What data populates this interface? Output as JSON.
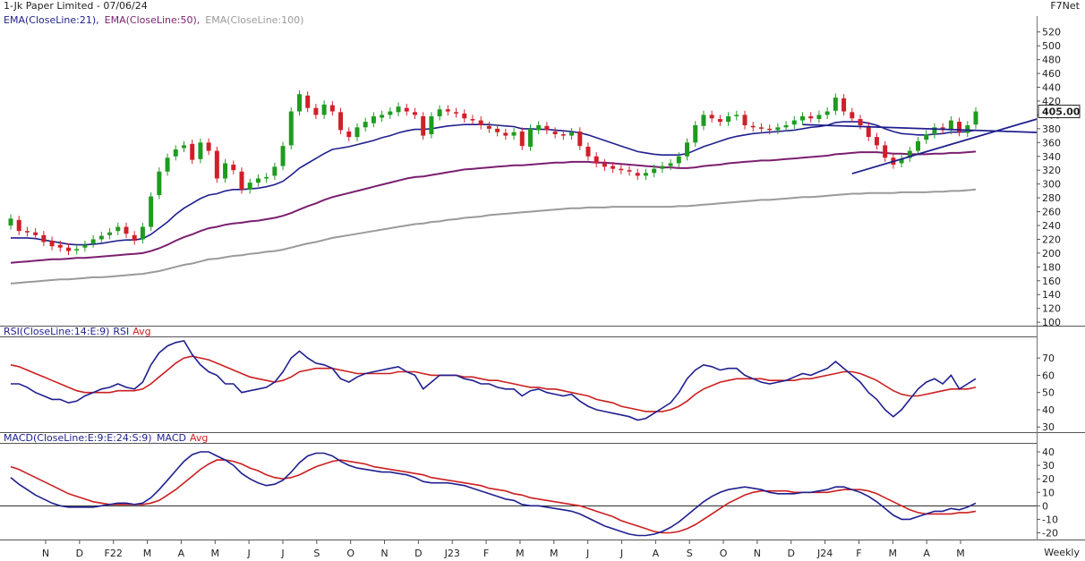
{
  "header": {
    "title": "1-Jk Paper Limited - 07/06/24",
    "source": "F7Net",
    "timeframe": "Weekly",
    "ema_legend": [
      {
        "label": "EMA(CloseLine:21),",
        "color": "#1f1f8f"
      },
      {
        "label": "EMA(CloseLine:50),",
        "color": "#7b1f6f"
      },
      {
        "label": "EMA(CloseLine:100)",
        "color": "#9a9a9a"
      }
    ],
    "rsi_legend": [
      {
        "label": "RSI(CloseLine:14:E:9)",
        "color": "#1f1f8f"
      },
      {
        "label": "RSI",
        "color": "#1f1f8f"
      },
      {
        "label": "Avg",
        "color": "#cc1f1f"
      }
    ],
    "macd_legend": [
      {
        "label": "MACD(CloseLine:E:9:E:24:S:9)_MACD",
        "color": "#1f1f8f"
      },
      {
        "label": "Avg",
        "color": "#cc1f1f"
      }
    ]
  },
  "chart_data": [
    {
      "type": "candlestick",
      "panel": "price",
      "yticks": [
        100,
        120,
        140,
        160,
        180,
        200,
        220,
        240,
        260,
        280,
        300,
        320,
        340,
        360,
        380,
        400,
        420,
        440,
        460,
        480,
        500,
        520
      ],
      "ylim": [
        95,
        530
      ],
      "last_price_label": "405.00",
      "x_labels": [
        "N",
        "D",
        "F22",
        "M",
        "A",
        "M",
        "J",
        "J",
        "S",
        "O",
        "N",
        "D",
        "J23",
        "F",
        "M",
        "M",
        "J",
        "J",
        "A",
        "S",
        "O",
        "N",
        "D",
        "J24",
        "F",
        "M",
        "A",
        "M"
      ],
      "close": [
        250,
        232,
        230,
        226,
        216,
        210,
        208,
        203,
        206,
        212,
        220,
        225,
        230,
        238,
        228,
        218,
        238,
        282,
        318,
        338,
        350,
        356,
        335,
        360,
        348,
        308,
        330,
        320,
        292,
        302,
        308,
        310,
        325,
        355,
        405,
        430,
        410,
        400,
        415,
        405,
        378,
        368,
        382,
        390,
        398,
        400,
        405,
        412,
        405,
        400,
        370,
        398,
        408,
        405,
        402,
        395,
        392,
        385,
        380,
        375,
        370,
        375,
        355,
        380,
        385,
        378,
        372,
        370,
        375,
        355,
        340,
        330,
        325,
        322,
        320,
        318,
        312,
        316,
        322,
        326,
        330,
        340,
        360,
        385,
        400,
        395,
        390,
        398,
        400,
        385,
        382,
        380,
        378,
        382,
        385,
        392,
        398,
        395,
        400,
        405,
        425,
        405,
        395,
        385,
        368,
        356,
        338,
        328,
        336,
        348,
        362,
        372,
        382,
        378,
        392,
        375,
        385,
        405
      ],
      "open": [
        240,
        248,
        232,
        230,
        226,
        218,
        212,
        208,
        204,
        208,
        214,
        220,
        226,
        232,
        238,
        226,
        220,
        238,
        284,
        318,
        340,
        352,
        358,
        336,
        360,
        348,
        308,
        328,
        318,
        292,
        302,
        308,
        312,
        326,
        356,
        405,
        428,
        410,
        400,
        414,
        404,
        376,
        368,
        382,
        388,
        396,
        400,
        404,
        410,
        404,
        398,
        372,
        398,
        408,
        404,
        402,
        394,
        392,
        384,
        380,
        374,
        370,
        376,
        354,
        378,
        384,
        376,
        372,
        370,
        376,
        354,
        340,
        330,
        326,
        322,
        320,
        316,
        312,
        316,
        322,
        326,
        330,
        340,
        360,
        384,
        400,
        394,
        390,
        398,
        400,
        384,
        382,
        380,
        378,
        382,
        386,
        392,
        398,
        394,
        400,
        406,
        424,
        404,
        394,
        384,
        368,
        356,
        338,
        330,
        338,
        348,
        364,
        372,
        382,
        378,
        390,
        374,
        386
      ],
      "ema21": [
        222,
        222,
        222,
        221,
        219,
        217,
        215,
        213,
        212,
        212,
        213,
        214,
        216,
        218,
        219,
        219,
        221,
        227,
        236,
        245,
        256,
        265,
        272,
        279,
        284,
        286,
        290,
        292,
        292,
        293,
        294,
        296,
        299,
        304,
        313,
        323,
        330,
        337,
        344,
        350,
        352,
        354,
        357,
        360,
        363,
        367,
        370,
        374,
        377,
        379,
        379,
        380,
        382,
        384,
        385,
        386,
        386,
        386,
        386,
        385,
        384,
        383,
        380,
        380,
        379,
        379,
        378,
        377,
        376,
        374,
        371,
        367,
        363,
        359,
        355,
        351,
        347,
        345,
        343,
        342,
        342,
        342,
        344,
        349,
        354,
        358,
        362,
        366,
        369,
        371,
        373,
        374,
        375,
        376,
        377,
        378,
        380,
        382,
        383,
        385,
        389,
        390,
        390,
        390,
        388,
        385,
        380,
        376,
        373,
        372,
        371,
        371,
        372,
        373,
        375,
        375,
        376,
        378
      ],
      "ema50": [
        186,
        187,
        188,
        189,
        190,
        191,
        191,
        192,
        193,
        193,
        194,
        195,
        196,
        197,
        198,
        199,
        200,
        203,
        207,
        212,
        218,
        223,
        227,
        232,
        236,
        238,
        241,
        243,
        244,
        246,
        247,
        249,
        251,
        254,
        258,
        263,
        268,
        272,
        277,
        281,
        284,
        287,
        290,
        293,
        296,
        299,
        302,
        305,
        308,
        310,
        311,
        313,
        315,
        317,
        319,
        321,
        322,
        323,
        324,
        325,
        326,
        327,
        327,
        328,
        329,
        330,
        331,
        331,
        332,
        332,
        332,
        331,
        331,
        330,
        329,
        328,
        327,
        326,
        325,
        324,
        324,
        323,
        323,
        324,
        326,
        327,
        328,
        330,
        331,
        332,
        333,
        334,
        334,
        335,
        336,
        337,
        338,
        339,
        340,
        341,
        343,
        344,
        345,
        346,
        346,
        346,
        345,
        344,
        344,
        343,
        343,
        343,
        344,
        344,
        345,
        345,
        346,
        347
      ],
      "ema100": [
        156,
        157,
        158,
        159,
        160,
        161,
        162,
        162,
        163,
        164,
        165,
        165,
        166,
        167,
        168,
        169,
        170,
        172,
        174,
        177,
        180,
        183,
        185,
        188,
        191,
        192,
        194,
        196,
        197,
        199,
        200,
        202,
        203,
        205,
        208,
        211,
        214,
        216,
        219,
        222,
        224,
        226,
        228,
        230,
        232,
        234,
        236,
        238,
        240,
        242,
        243,
        245,
        246,
        248,
        249,
        251,
        252,
        253,
        255,
        256,
        257,
        258,
        259,
        260,
        261,
        262,
        263,
        264,
        265,
        265,
        266,
        266,
        266,
        267,
        267,
        267,
        267,
        267,
        267,
        267,
        267,
        268,
        268,
        269,
        270,
        271,
        272,
        273,
        274,
        275,
        276,
        277,
        277,
        278,
        279,
        280,
        281,
        281,
        282,
        283,
        284,
        285,
        286,
        286,
        287,
        287,
        287,
        287,
        288,
        288,
        288,
        288,
        289,
        289,
        290,
        290,
        291,
        292
      ],
      "trendline_upper": [
        {
          "week": 96,
          "price": 386
        },
        {
          "week": 121,
          "price": 376
        }
      ],
      "trendline_lower": [
        {
          "week": 102,
          "price": 315
        },
        {
          "week": 121,
          "price": 382
        }
      ]
    },
    {
      "type": "line",
      "panel": "rsi",
      "yticks": [
        30,
        40,
        50,
        60,
        70
      ],
      "ylim": [
        27,
        82
      ],
      "series": [
        {
          "name": "RSI",
          "color": "#1f1f8f",
          "values": [
            55,
            55,
            53,
            50,
            48,
            46,
            46,
            44,
            45,
            48,
            50,
            52,
            53,
            55,
            53,
            52,
            56,
            66,
            73,
            77,
            79,
            80,
            72,
            66,
            62,
            60,
            55,
            55,
            50,
            51,
            52,
            53,
            56,
            62,
            70,
            74,
            70,
            67,
            66,
            64,
            58,
            56,
            59,
            61,
            62,
            63,
            64,
            65,
            62,
            60,
            52,
            56,
            60,
            60,
            60,
            58,
            57,
            55,
            55,
            53,
            52,
            52,
            48,
            51,
            52,
            50,
            49,
            48,
            49,
            45,
            42,
            40,
            39,
            38,
            37,
            36,
            34,
            35,
            38,
            41,
            44,
            50,
            58,
            63,
            66,
            65,
            63,
            64,
            64,
            60,
            58,
            56,
            55,
            56,
            57,
            59,
            61,
            60,
            62,
            64,
            68,
            64,
            60,
            56,
            50,
            46,
            40,
            36,
            40,
            46,
            52,
            56,
            58,
            55,
            60,
            52,
            55,
            58
          ]
        },
        {
          "name": "Avg",
          "color": "#cc1f1f",
          "values": [
            66,
            65,
            63,
            61,
            59,
            57,
            55,
            53,
            51,
            50,
            50,
            50,
            50,
            51,
            51,
            51,
            52,
            55,
            59,
            63,
            67,
            70,
            71,
            70,
            69,
            67,
            65,
            63,
            61,
            59,
            58,
            57,
            56,
            57,
            59,
            62,
            63,
            64,
            64,
            64,
            63,
            62,
            61,
            61,
            61,
            61,
            61,
            62,
            62,
            62,
            61,
            60,
            60,
            60,
            60,
            59,
            59,
            58,
            57,
            57,
            56,
            55,
            54,
            53,
            53,
            52,
            52,
            51,
            50,
            49,
            48,
            46,
            45,
            44,
            42,
            41,
            40,
            39,
            39,
            39,
            40,
            42,
            45,
            49,
            52,
            54,
            56,
            57,
            58,
            58,
            58,
            58,
            57,
            57,
            57,
            57,
            58,
            58,
            59,
            60,
            61,
            62,
            62,
            61,
            59,
            57,
            54,
            51,
            49,
            48,
            48,
            49,
            50,
            51,
            52,
            52,
            52,
            53
          ]
        }
      ]
    },
    {
      "type": "line",
      "panel": "macd",
      "yticks": [
        -20,
        -10,
        0,
        10,
        20,
        30,
        40
      ],
      "ylim": [
        -25,
        46
      ],
      "series": [
        {
          "name": "MACD",
          "color": "#1f1f8f",
          "values": [
            21,
            16,
            12,
            8,
            5,
            2,
            0,
            -1,
            -1,
            -1,
            -1,
            0,
            1,
            2,
            2,
            1,
            2,
            6,
            12,
            19,
            26,
            33,
            38,
            40,
            40,
            37,
            34,
            30,
            24,
            20,
            17,
            15,
            16,
            19,
            25,
            32,
            37,
            39,
            39,
            37,
            33,
            30,
            28,
            27,
            26,
            25,
            25,
            24,
            23,
            21,
            18,
            17,
            17,
            17,
            16,
            15,
            13,
            11,
            9,
            7,
            5,
            4,
            1,
            0,
            0,
            -1,
            -2,
            -3,
            -4,
            -6,
            -9,
            -12,
            -15,
            -17,
            -19,
            -21,
            -22,
            -22,
            -21,
            -19,
            -16,
            -12,
            -7,
            -2,
            3,
            7,
            10,
            12,
            13,
            14,
            13,
            12,
            10,
            9,
            9,
            9,
            10,
            10,
            11,
            12,
            14,
            14,
            12,
            10,
            7,
            3,
            -2,
            -7,
            -10,
            -10,
            -8,
            -6,
            -4,
            -4,
            -2,
            -3,
            -1,
            2
          ]
        },
        {
          "name": "Avg",
          "color": "#cc1f1f",
          "values": [
            29,
            27,
            24,
            21,
            18,
            15,
            12,
            9,
            7,
            5,
            3,
            2,
            1,
            1,
            1,
            1,
            1,
            2,
            4,
            8,
            12,
            17,
            22,
            27,
            31,
            34,
            34,
            33,
            31,
            28,
            26,
            23,
            21,
            20,
            21,
            23,
            26,
            29,
            31,
            33,
            34,
            33,
            32,
            31,
            29,
            28,
            27,
            26,
            25,
            24,
            23,
            21,
            20,
            19,
            18,
            17,
            16,
            15,
            13,
            12,
            11,
            9,
            8,
            6,
            5,
            4,
            3,
            2,
            1,
            0,
            -2,
            -4,
            -6,
            -8,
            -11,
            -13,
            -15,
            -17,
            -19,
            -20,
            -20,
            -19,
            -17,
            -14,
            -10,
            -6,
            -2,
            2,
            5,
            8,
            10,
            11,
            11,
            11,
            11,
            10,
            10,
            10,
            10,
            10,
            11,
            12,
            12,
            12,
            11,
            9,
            6,
            3,
            0,
            -3,
            -5,
            -6,
            -6,
            -6,
            -6,
            -5,
            -5,
            -4
          ]
        }
      ]
    }
  ]
}
